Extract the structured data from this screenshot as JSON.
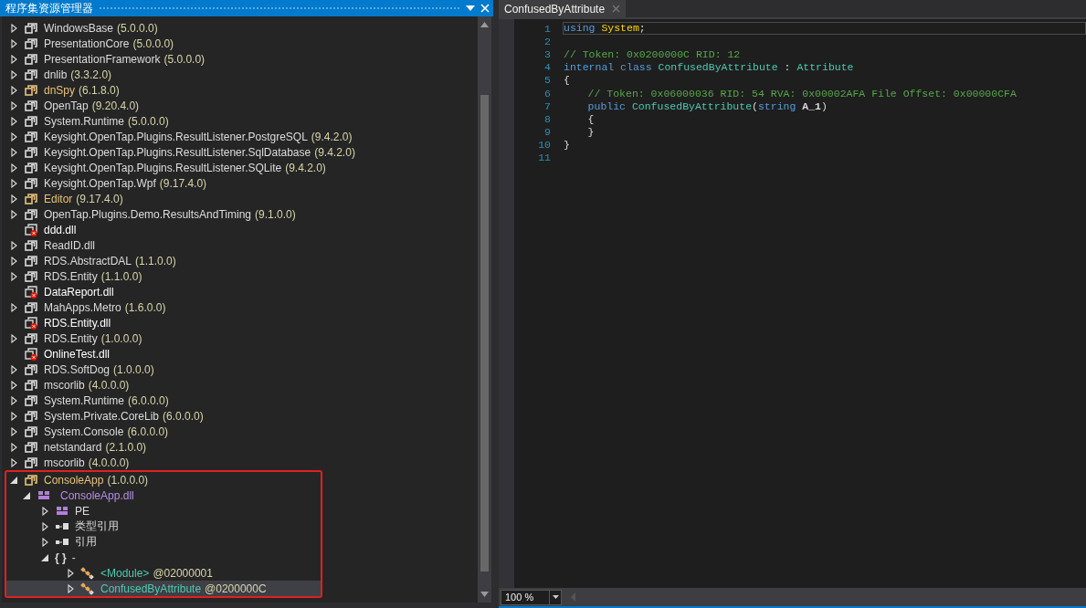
{
  "explorer": {
    "title": "程序集资源管理器",
    "items": [
      {
        "kind": "assembly",
        "name": "WindowsBase",
        "version": "(5.0.0.0)",
        "expanded": false,
        "selected": false
      },
      {
        "kind": "assembly",
        "name": "PresentationCore",
        "version": "(5.0.0.0)",
        "expanded": false,
        "selected": false
      },
      {
        "kind": "assembly",
        "name": "PresentationFramework",
        "version": "(5.0.0.0)",
        "expanded": false,
        "selected": false
      },
      {
        "kind": "assembly",
        "name": "dnlib",
        "version": "(3.3.2.0)",
        "expanded": false,
        "selected": false
      },
      {
        "kind": "exe",
        "name": "dnSpy",
        "version": "(6.1.8.0)",
        "expanded": false,
        "selected": false
      },
      {
        "kind": "assembly",
        "name": "OpenTap",
        "version": "(9.20.4.0)",
        "expanded": false,
        "selected": false
      },
      {
        "kind": "assembly",
        "name": "System.Runtime",
        "version": "(5.0.0.0)",
        "expanded": false,
        "selected": false
      },
      {
        "kind": "assembly",
        "name": "Keysight.OpenTap.Plugins.ResultListener.PostgreSQL",
        "version": "(9.4.2.0)",
        "expanded": false,
        "selected": false
      },
      {
        "kind": "assembly",
        "name": "Keysight.OpenTap.Plugins.ResultListener.SqlDatabase",
        "version": "(9.4.2.0)",
        "expanded": false,
        "selected": false
      },
      {
        "kind": "assembly",
        "name": "Keysight.OpenTap.Plugins.ResultListener.SQLite",
        "version": "(9.4.2.0)",
        "expanded": false,
        "selected": false
      },
      {
        "kind": "assembly",
        "name": "Keysight.OpenTap.Wpf",
        "version": "(9.17.4.0)",
        "expanded": false,
        "selected": false
      },
      {
        "kind": "exe",
        "name": "Editor",
        "version": "(9.17.4.0)",
        "expanded": false,
        "selected": false
      },
      {
        "kind": "assembly",
        "name": "OpenTap.Plugins.Demo.ResultsAndTiming",
        "version": "(9.1.0.0)",
        "expanded": false,
        "selected": false
      },
      {
        "kind": "missing",
        "name": "ddd.dll",
        "selected": false
      },
      {
        "kind": "assembly",
        "name": "ReadID.dll",
        "expanded": false,
        "selected": false
      },
      {
        "kind": "assembly",
        "name": "RDS.AbstractDAL",
        "version": "(1.1.0.0)",
        "expanded": false,
        "selected": false
      },
      {
        "kind": "assembly",
        "name": "RDS.Entity",
        "version": "(1.1.0.0)",
        "expanded": false,
        "selected": false
      },
      {
        "kind": "missing",
        "name": "DataReport.dll",
        "selected": false
      },
      {
        "kind": "assembly",
        "name": "MahApps.Metro",
        "version": "(1.6.0.0)",
        "expanded": false,
        "selected": false
      },
      {
        "kind": "missing",
        "name": "RDS.Entity.dll",
        "selected": false
      },
      {
        "kind": "assembly",
        "name": "RDS.Entity",
        "version": "(1.0.0.0)",
        "expanded": false,
        "selected": false
      },
      {
        "kind": "missing",
        "name": "OnlineTest.dll",
        "selected": false
      },
      {
        "kind": "assembly",
        "name": "RDS.SoftDog",
        "version": "(1.0.0.0)",
        "expanded": false,
        "selected": false
      },
      {
        "kind": "assembly",
        "name": "mscorlib",
        "version": "(4.0.0.0)",
        "expanded": false,
        "selected": false
      },
      {
        "kind": "assembly",
        "name": "System.Runtime",
        "version": "(6.0.0.0)",
        "expanded": false,
        "selected": false
      },
      {
        "kind": "assembly",
        "name": "System.Private.CoreLib",
        "version": "(6.0.0.0)",
        "expanded": false,
        "selected": false
      },
      {
        "kind": "assembly",
        "name": "System.Console",
        "version": "(6.0.0.0)",
        "expanded": false,
        "selected": false
      },
      {
        "kind": "assembly",
        "name": "netstandard",
        "version": "(2.1.0.0)",
        "expanded": false,
        "selected": false
      },
      {
        "kind": "assembly",
        "name": "mscorlib",
        "version": "(4.0.0.0)",
        "expanded": false,
        "selected": false
      },
      {
        "kind": "exe",
        "name": "ConsoleApp",
        "version": "(1.0.0.0)",
        "expanded": true,
        "selected": false,
        "highlighted": true,
        "children": [
          {
            "kind": "module",
            "name": "ConsoleApp.dll",
            "expanded": true,
            "selected": false,
            "children": [
              {
                "kind": "pe",
                "name": "PE",
                "expanded": false,
                "selected": false
              },
              {
                "kind": "refs",
                "name": "类型引用",
                "expanded": false,
                "selected": false
              },
              {
                "kind": "refs",
                "name": "引用",
                "expanded": false,
                "selected": false
              },
              {
                "kind": "namespace",
                "glyph": "{ }",
                "name": "-",
                "expanded": true,
                "selected": false,
                "children": [
                  {
                    "kind": "type",
                    "name": "<Module>",
                    "token": "@02000001",
                    "expanded": false,
                    "selected": false
                  },
                  {
                    "kind": "type",
                    "name": "ConfusedByAttribute",
                    "token": "@0200000C",
                    "expanded": false,
                    "selected": true
                  }
                ]
              }
            ]
          }
        ]
      }
    ]
  },
  "editor": {
    "tab": "ConfusedByAttribute",
    "zoom": "100 %",
    "lines": [
      {
        "number": "1",
        "current": true,
        "indented": false,
        "tokens": [
          {
            "kind": "keyword",
            "text": "using"
          },
          {
            "kind": "namespace",
            "text": " System"
          },
          {
            "kind": "plain",
            "text": ";"
          }
        ]
      },
      {
        "number": "2",
        "current": false
      },
      {
        "number": "3",
        "current": false,
        "indented": false,
        "tokens": [
          {
            "kind": "comment",
            "text": "// Token: 0x0200000C RID: 12"
          }
        ]
      },
      {
        "number": "4",
        "current": false,
        "indented": false,
        "tokens": [
          {
            "kind": "keyword",
            "text": "internal"
          },
          {
            "kind": "keyword",
            "text": " class"
          },
          {
            "kind": "type",
            "text": " ConfusedByAttribute"
          },
          {
            "kind": "plain",
            "text": " :"
          },
          {
            "kind": "type",
            "text": " Attribute"
          }
        ]
      },
      {
        "number": "5",
        "current": false,
        "indented": false,
        "tokens": [
          {
            "kind": "plain",
            "text": "{"
          }
        ]
      },
      {
        "number": "6",
        "current": false,
        "indented": true,
        "tokens": [
          {
            "kind": "comment",
            "text": "// Token: 0x06000036 RID: 54 RVA: 0x00002AFA File Offset: 0x00000CFA"
          }
        ]
      },
      {
        "number": "7",
        "current": false,
        "indented": true,
        "tokens": [
          {
            "kind": "keyword",
            "text": "public"
          },
          {
            "kind": "type",
            "text": " ConfusedByAttribute"
          },
          {
            "kind": "plain",
            "text": "("
          },
          {
            "kind": "keyword",
            "text": "string"
          },
          {
            "kind": "param",
            "text": " A_1"
          },
          {
            "kind": "plain",
            "text": ")"
          }
        ]
      },
      {
        "number": "8",
        "current": false,
        "indented": true,
        "tokens": [
          {
            "kind": "plain",
            "text": "{"
          }
        ]
      },
      {
        "number": "9",
        "current": false,
        "indented": true,
        "tokens": [
          {
            "kind": "plain",
            "text": "}"
          }
        ]
      },
      {
        "number": "10",
        "current": false,
        "indented": false,
        "tokens": [
          {
            "kind": "plain",
            "text": "}"
          }
        ]
      },
      {
        "number": "11",
        "current": false
      }
    ]
  }
}
